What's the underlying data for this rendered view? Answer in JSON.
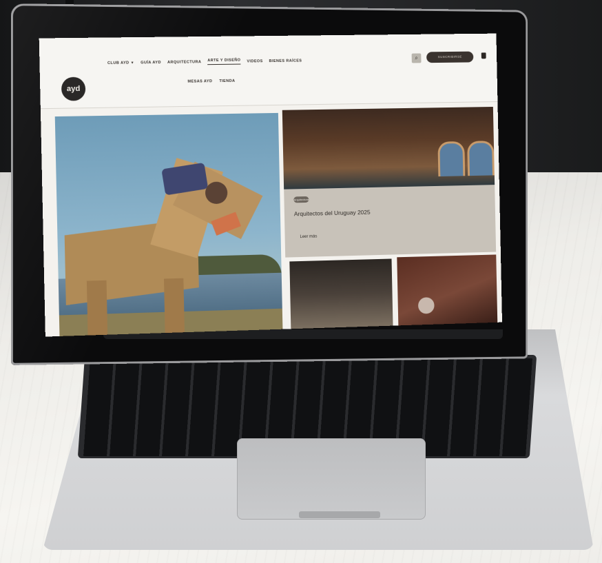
{
  "site": {
    "logo_text": "ayd",
    "nav_row1": [
      {
        "label": "CLUB AYD",
        "has_dropdown": true
      },
      {
        "label": "GUÍA AYD"
      },
      {
        "label": "ARQUITECTURA"
      },
      {
        "label": "ARTE Y DISEÑO",
        "active": true
      },
      {
        "label": "VIDEOS"
      },
      {
        "label": "BIENES RAÍCES"
      }
    ],
    "nav_row2": [
      {
        "label": "MESAS AYD"
      },
      {
        "label": "TIENDA"
      }
    ],
    "cta_label": "SUSCRIBIRSE",
    "search_icon": "search-icon",
    "bag_icon": "shopping-bag-icon"
  },
  "featured_card": {
    "badge": "Arquitectura",
    "title": "Arquitectos del Uruguay 2025",
    "link": "Leer más"
  },
  "colors": {
    "topbar_bg": "#f6f5f2",
    "cta_bg": "#3a332f",
    "card_bg": "#c8c2b9"
  }
}
